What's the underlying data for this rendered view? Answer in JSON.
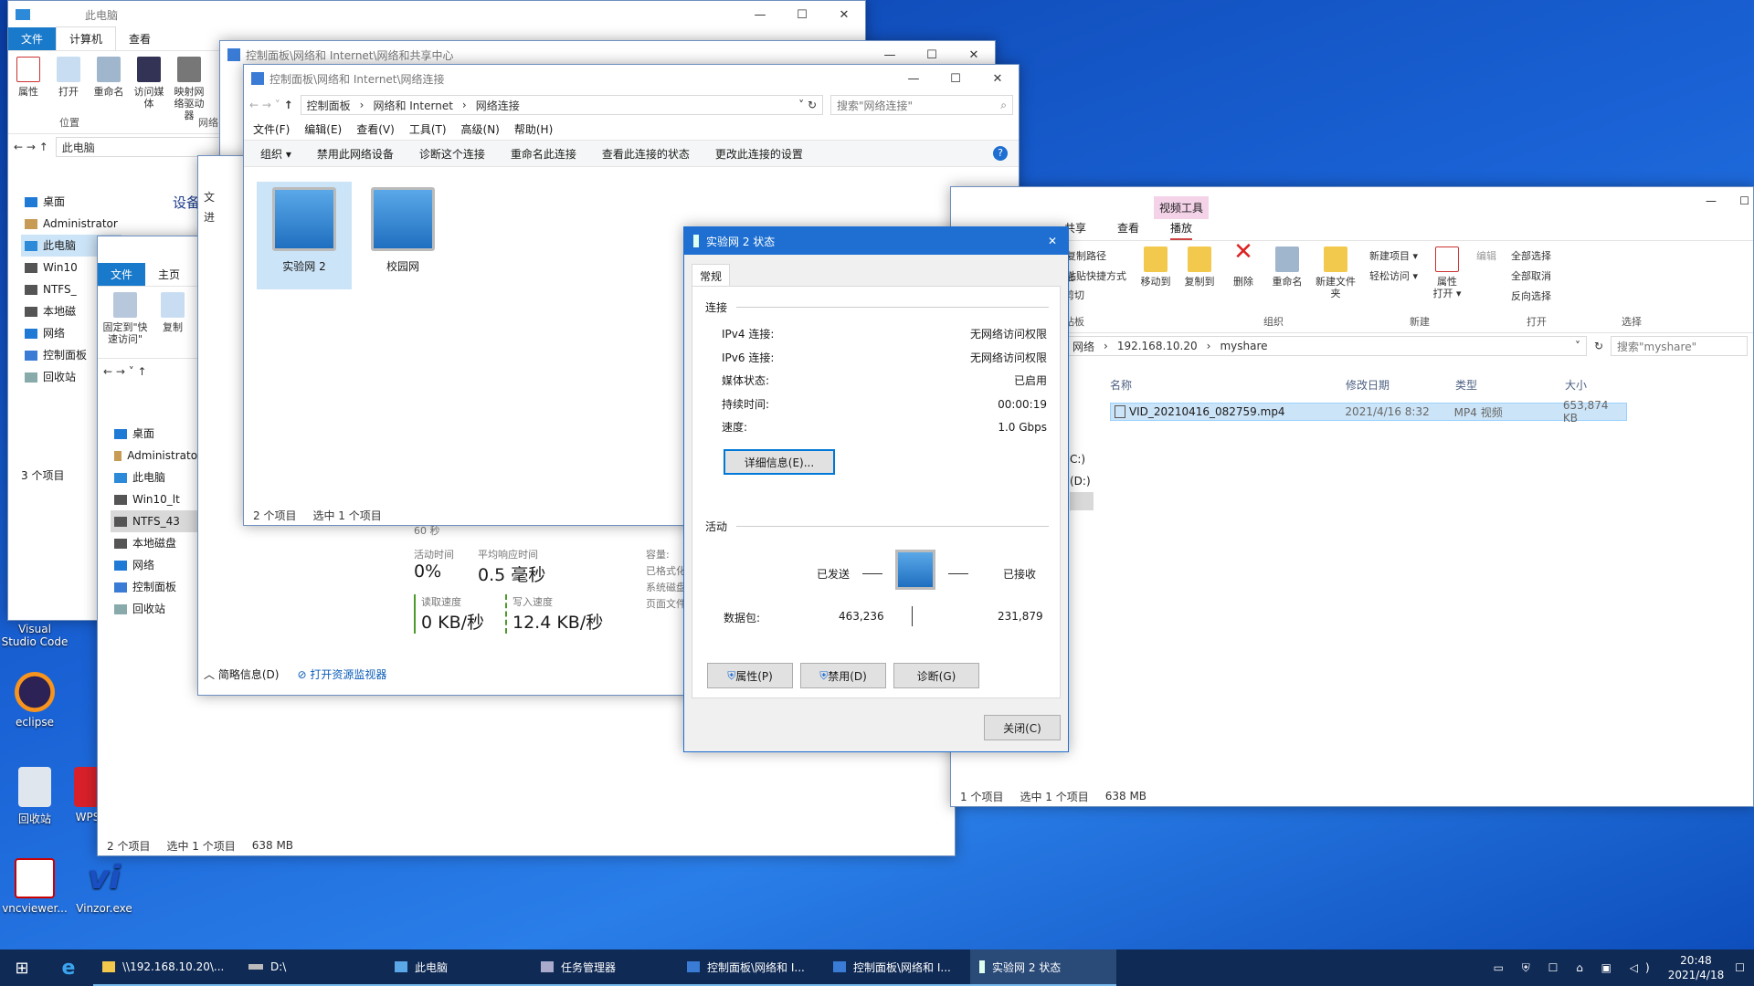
{
  "desktop": {
    "icons": [
      {
        "label": "Visual Studio Code"
      },
      {
        "label": "eclipse"
      },
      {
        "label": "回收站"
      },
      {
        "label": "WPS"
      },
      {
        "label": "vncviewer..."
      },
      {
        "label": "Vinzor.exe"
      }
    ]
  },
  "win_pc": {
    "title": "此电脑",
    "tabs": [
      "文件",
      "计算机",
      "查看"
    ],
    "ribbon": [
      "属性",
      "打开",
      "重命名",
      "访问媒体",
      "映射网络驱动器"
    ],
    "group": "位置",
    "group2": "网络",
    "path": "此电脑",
    "nav": [
      "桌面",
      "Administrator",
      "此电脑",
      "Win10",
      "NTFS_",
      "本地磁",
      "网络",
      "控制面板",
      "回收站"
    ],
    "devices": "设备",
    "status": "3 个项目"
  },
  "win_pc2": {
    "tabs": [
      "文件",
      "主页"
    ],
    "ribbon": [
      "固定到\"快速访问\"",
      "复制"
    ],
    "nav": [
      "桌面",
      "Administrator",
      "此电脑",
      "Win10_lt",
      "NTFS_43",
      "本地磁盘",
      "网络",
      "控制面板",
      "回收站"
    ],
    "status": "2 个项目",
    "status2": "选中 1 个项目",
    "status3": "638 MB"
  },
  "win_share": {
    "title": "控制面板\\网络和 Internet\\网络和共享中心"
  },
  "win_tm": {
    "left_labels": [
      "文",
      "进"
    ],
    "l60": "60 秒",
    "active_label": "活动时间",
    "active": "0%",
    "resp_label": "平均响应时间",
    "resp": "0.5 毫秒",
    "read_label": "读取速度",
    "read": "0 KB/秒",
    "write_label": "写入速度",
    "write": "12.4 KB/秒",
    "cap": [
      "容量:",
      "已格式化",
      "系统磁盘",
      "页面文件"
    ],
    "brief": "简略信息(D)",
    "resmon": "打开资源监视器"
  },
  "win_nc": {
    "title": "控制面板\\网络和 Internet\\网络连接",
    "path": [
      "控制面板",
      "网络和 Internet",
      "网络连接"
    ],
    "search": "搜索\"网络连接\"",
    "menu": [
      "文件(F)",
      "编辑(E)",
      "查看(V)",
      "工具(T)",
      "高级(N)",
      "帮助(H)"
    ],
    "cmd": [
      "组织 ▾",
      "禁用此网络设备",
      "诊断这个连接",
      "重命名此连接",
      "查看此连接的状态",
      "更改此连接的设置"
    ],
    "items": [
      "实验网 2",
      "校园网"
    ],
    "status": "2 个项目",
    "status2": "选中 1 个项目"
  },
  "win_share2": {
    "tool": "视频工具",
    "tabs": [
      "共享",
      "查看",
      "播放"
    ],
    "ribbon": [
      "复制路径",
      "粘贴快捷方式",
      "移动到",
      "复制到",
      "删除",
      "重命名",
      "新建文件夹",
      "新建项目 ▾",
      "轻松访问 ▾",
      "属性",
      "打开 ▾",
      "编辑",
      "全部选择",
      "全部取消",
      "反向选择"
    ],
    "groups": [
      "组织",
      "新建",
      "打开",
      "选择"
    ],
    "left": [
      "粘",
      "剪切",
      "贴板"
    ],
    "path": [
      "网络",
      "192.168.10.20",
      "myshare"
    ],
    "search": "搜索\"myshare\"",
    "cols": [
      "名称",
      "修改日期",
      "类型",
      "大小"
    ],
    "file": {
      "name": "VID_20210416_082759.mp4",
      "date": "2021/4/16 8:32",
      "type": "MP4 视频",
      "size": "653,874 KB"
    },
    "drives": [
      "C:)",
      "(D:)"
    ],
    "status": "1 个项目",
    "status2": "选中 1 个项目",
    "status3": "638 MB"
  },
  "dlg": {
    "title": "实验网 2 状态",
    "tab": "常规",
    "conn": "连接",
    "rows": [
      {
        "k": "IPv4 连接:",
        "v": "无网络访问权限"
      },
      {
        "k": "IPv6 连接:",
        "v": "无网络访问权限"
      },
      {
        "k": "媒体状态:",
        "v": "已启用"
      },
      {
        "k": "持续时间:",
        "v": "00:00:19"
      },
      {
        "k": "速度:",
        "v": "1.0 Gbps"
      }
    ],
    "details": "详细信息(E)...",
    "activity": "活动",
    "sent": "已发送",
    "recv": "已接收",
    "packets": "数据包:",
    "sent_n": "463,236",
    "recv_n": "231,879",
    "props": "属性(P)",
    "disable": "禁用(D)",
    "diag": "诊断(G)",
    "close": "关闭(C)"
  },
  "taskbar": {
    "items": [
      "\\\\192.168.10.20\\...",
      "D:\\",
      "此电脑",
      "任务管理器",
      "控制面板\\网络和 I...",
      "控制面板\\网络和 I...",
      "实验网 2 状态"
    ],
    "time": "20:48",
    "date": "2021/4/18"
  }
}
